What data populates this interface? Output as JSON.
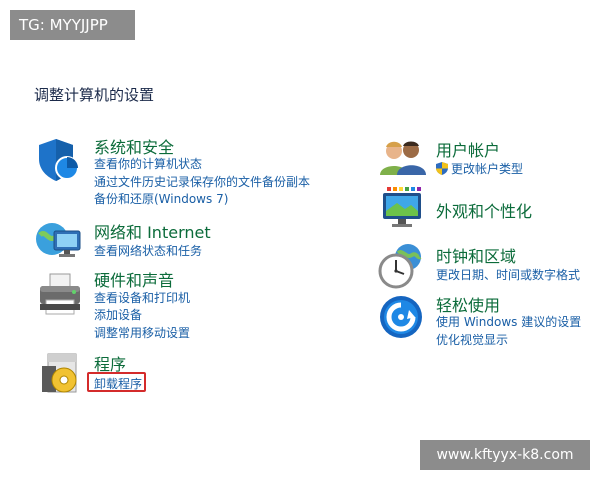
{
  "overlays": {
    "tg_label": "TG: MYYJJPP",
    "url_label": "www.kftyyx-k8.com"
  },
  "page": {
    "title": "调整计算机的设置"
  },
  "left_categories": [
    {
      "title": "系统和安全",
      "icon": "security-shield-icon",
      "links": [
        "查看你的计算机状态",
        "通过文件历史记录保存你的文件备份副本",
        "备份和还原(Windows 7)"
      ]
    },
    {
      "title": "网络和 Internet",
      "icon": "network-globe-icon",
      "links": [
        "查看网络状态和任务"
      ]
    },
    {
      "title": "硬件和声音",
      "icon": "printer-icon",
      "links": [
        "查看设备和打印机",
        "添加设备",
        "调整常用移动设置"
      ]
    },
    {
      "title": "程序",
      "icon": "programs-disc-icon",
      "links": [
        "卸载程序"
      ]
    }
  ],
  "right_categories": [
    {
      "title": "用户帐户",
      "icon": "user-accounts-icon",
      "links": [
        "更改帐户类型"
      ]
    },
    {
      "title": "外观和个性化",
      "icon": "appearance-monitor-icon",
      "links": []
    },
    {
      "title": "时钟和区域",
      "icon": "clock-globe-icon",
      "links": [
        "更改日期、时间或数字格式"
      ]
    },
    {
      "title": "轻松使用",
      "icon": "ease-of-access-icon",
      "links": [
        "使用 Windows 建议的设置",
        "优化视觉显示"
      ]
    }
  ],
  "colors": {
    "title_green": "#0b6b3a",
    "link_blue": "#1a5fa6",
    "highlight_red": "#d42b2b",
    "overlay_gray": "#8c8c8c"
  }
}
